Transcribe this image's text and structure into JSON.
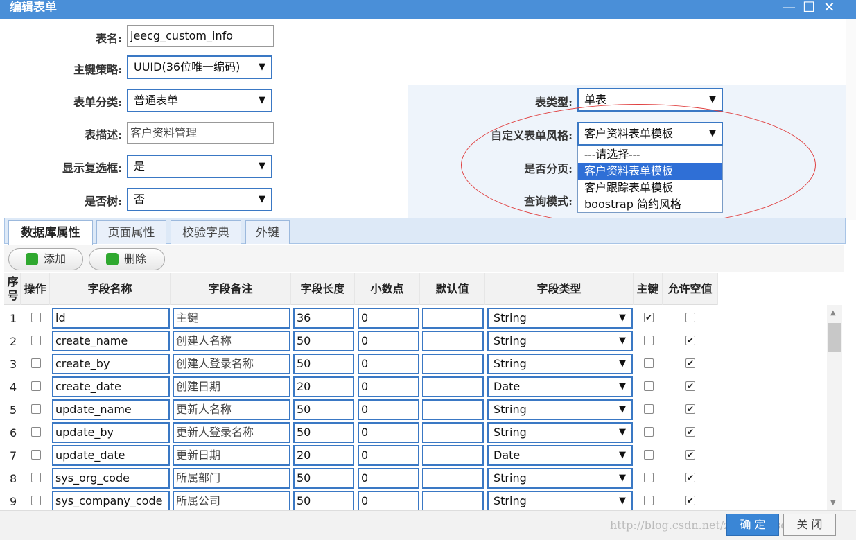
{
  "window": {
    "title": "编辑表单",
    "controls": [
      "—",
      "☐",
      "✕"
    ]
  },
  "form": {
    "table_name_label": "表名:",
    "table_name_value": "jeecg_custom_info",
    "pk_label": "主键策略:",
    "pk_value": "UUID(36位唯一编码)",
    "category_label": "表单分类:",
    "category_value": "普通表单",
    "desc_label": "表描述:",
    "desc_value": "客户资料管理",
    "checkbox_label": "显示复选框:",
    "checkbox_value": "是",
    "tree_label": "是否树:",
    "tree_value": "否",
    "table_type_label": "表类型:",
    "table_type_value": "单表",
    "style_label": "自定义表单风格:",
    "style_value": "客户资料表单模板",
    "paging_label": "是否分页:",
    "query_label": "查询模式:"
  },
  "dropdown": {
    "options": [
      "---请选择---",
      "客户资料表单模板",
      "客户跟踪表单模板",
      "boostrap 简约风格"
    ],
    "selected_index": 1
  },
  "tabs": [
    "数据库属性",
    "页面属性",
    "校验字典",
    "外键"
  ],
  "toolbar": {
    "add_label": "添加",
    "delete_label": "删除"
  },
  "grid": {
    "headers": {
      "seq": "序号",
      "op": "操作",
      "field_name": "字段名称",
      "field_note": "字段备注",
      "field_length": "字段长度",
      "decimal": "小数点",
      "default": "默认值",
      "field_type": "字段类型",
      "pk": "主键",
      "nullable": "允许空值"
    },
    "rows": [
      {
        "n": "1",
        "name": "id",
        "note": "主键",
        "len": "36",
        "dec": "0",
        "def": "",
        "type": "String",
        "pk": true,
        "nullable": false
      },
      {
        "n": "2",
        "name": "create_name",
        "note": "创建人名称",
        "len": "50",
        "dec": "0",
        "def": "",
        "type": "String",
        "pk": false,
        "nullable": true
      },
      {
        "n": "3",
        "name": "create_by",
        "note": "创建人登录名称",
        "len": "50",
        "dec": "0",
        "def": "",
        "type": "String",
        "pk": false,
        "nullable": true
      },
      {
        "n": "4",
        "name": "create_date",
        "note": "创建日期",
        "len": "20",
        "dec": "0",
        "def": "",
        "type": "Date",
        "pk": false,
        "nullable": true
      },
      {
        "n": "5",
        "name": "update_name",
        "note": "更新人名称",
        "len": "50",
        "dec": "0",
        "def": "",
        "type": "String",
        "pk": false,
        "nullable": true
      },
      {
        "n": "6",
        "name": "update_by",
        "note": "更新人登录名称",
        "len": "50",
        "dec": "0",
        "def": "",
        "type": "String",
        "pk": false,
        "nullable": true
      },
      {
        "n": "7",
        "name": "update_date",
        "note": "更新日期",
        "len": "20",
        "dec": "0",
        "def": "",
        "type": "Date",
        "pk": false,
        "nullable": true
      },
      {
        "n": "8",
        "name": "sys_org_code",
        "note": "所属部门",
        "len": "50",
        "dec": "0",
        "def": "",
        "type": "String",
        "pk": false,
        "nullable": true
      },
      {
        "n": "9",
        "name": "sys_company_code",
        "note": "所属公司",
        "len": "50",
        "dec": "0",
        "def": "",
        "type": "String",
        "pk": false,
        "nullable": true
      }
    ]
  },
  "footer": {
    "ok_label": "确 定",
    "close_label": "关 闭",
    "watermark": "http://blog.csdn.net/zhangdaiscott"
  },
  "colors": {
    "accent": "#3a78c4",
    "titlebar": "#4a8fd8",
    "annotation": "#e04040"
  }
}
